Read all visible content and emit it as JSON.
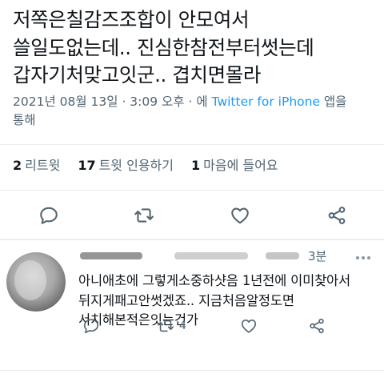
{
  "tweet": {
    "text_lines": [
      "저쪽은칠감즈조합이 안모여서",
      "쓸일도없는데.. 진심한참전부터썻는데",
      "갑자기처맞고잇군.. 겹치면몰라"
    ],
    "time": "2021년 08월 13일 · 3:09 오후 · 에",
    "source": "Twitter for iPhone",
    "via_suffix": "앱을",
    "via_line2": "통해"
  },
  "stats": {
    "retweets_count": "2",
    "retweets_label": "리트윗",
    "quotes_count": "17",
    "quotes_label": "트윗 인용하기",
    "likes_count": "1",
    "likes_label": "마음에 들어요"
  },
  "actions": {
    "reply_icon": "comment-icon",
    "retweet_icon": "retweet-icon",
    "like_icon": "heart-icon",
    "share_icon": "share-icon"
  },
  "reply": {
    "time": "3분",
    "text_lines": [
      "아니애초에 그렇게소중하샷음 1년전에 이미찾아서",
      "뒤지게패고안썻겠죠.. 지금처음알정도면",
      "서치해본적은잇는건가"
    ],
    "retweet_count": "4"
  },
  "colors": {
    "text_primary": "#0f1419",
    "text_secondary": "#536471",
    "link": "#1d9bf0",
    "divider": "#e6ecf0"
  }
}
